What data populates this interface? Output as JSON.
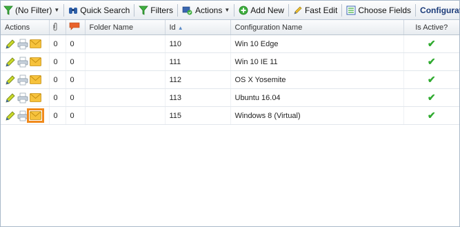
{
  "toolbar": {
    "filter_label": "(No Filter)",
    "quick_search_label": "Quick Search",
    "filters_label": "Filters",
    "actions_label": "Actions",
    "add_new_label": "Add New",
    "fast_edit_label": "Fast Edit",
    "choose_fields_label": "Choose Fields",
    "title": "Configurations"
  },
  "columns": {
    "actions": "Actions",
    "folder_name": "Folder Name",
    "id": "Id",
    "configuration_name": "Configuration Name",
    "is_active": "Is Active?"
  },
  "rows": [
    {
      "attachments": "0",
      "comments": "0",
      "folder": "",
      "id": "110",
      "name": "Win 10 Edge",
      "active": "✔"
    },
    {
      "attachments": "0",
      "comments": "0",
      "folder": "",
      "id": "111",
      "name": "Win 10 IE 11",
      "active": "✔"
    },
    {
      "attachments": "0",
      "comments": "0",
      "folder": "",
      "id": "112",
      "name": "OS X Yosemite",
      "active": "✔"
    },
    {
      "attachments": "0",
      "comments": "0",
      "folder": "",
      "id": "113",
      "name": "Ubuntu 16.04",
      "active": "✔"
    },
    {
      "attachments": "0",
      "comments": "0",
      "folder": "",
      "id": "115",
      "name": "Windows 8 (Virtual)",
      "active": "✔"
    }
  ],
  "colors": {
    "accent": "#1c3c7a",
    "highlight": "#f08a1c",
    "check": "#2faa2f"
  }
}
